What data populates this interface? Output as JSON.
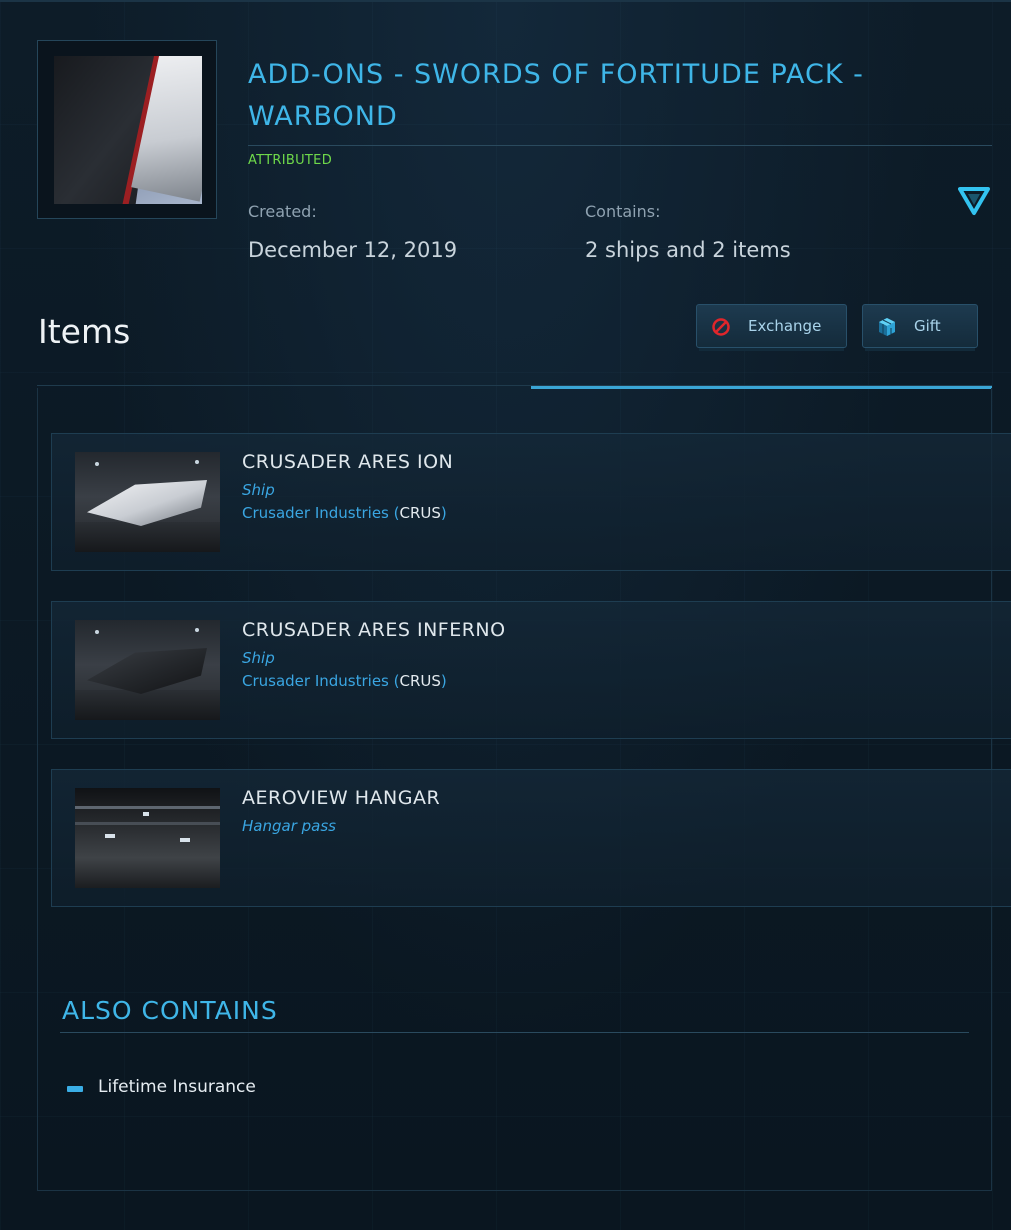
{
  "pledge": {
    "title": "ADD-ONS - SWORDS OF FORTITUDE PACK - WARBOND",
    "status": "ATTRIBUTED",
    "created_label": "Created:",
    "created_value": "December 12, 2019",
    "contains_label": "Contains:",
    "contains_value": "2 ships and 2 items",
    "toggle_icon": "triangle-down-icon"
  },
  "items_section": {
    "heading": "Items",
    "buttons": [
      {
        "label": "Exchange",
        "icon": "no-entry-icon",
        "color": "#e0262b"
      },
      {
        "label": "Gift",
        "icon": "gift-cube-icon",
        "color": "#3bb9e8"
      }
    ],
    "items": [
      {
        "name": "CRUSADER ARES ION",
        "type": "Ship",
        "manufacturer": "Crusader Industries (",
        "code": "CRUS",
        "close": ")"
      },
      {
        "name": "CRUSADER ARES INFERNO",
        "type": "Ship",
        "manufacturer": "Crusader Industries (",
        "code": "CRUS",
        "close": ")"
      },
      {
        "name": "AEROVIEW HANGAR",
        "type": "Hangar pass"
      }
    ]
  },
  "also_contains": {
    "heading": "ALSO CONTAINS",
    "items": [
      "Lifetime Insurance"
    ]
  },
  "colors": {
    "accent": "#3fb6e8",
    "status_green": "#6fd94a",
    "background": "#0b1822"
  }
}
